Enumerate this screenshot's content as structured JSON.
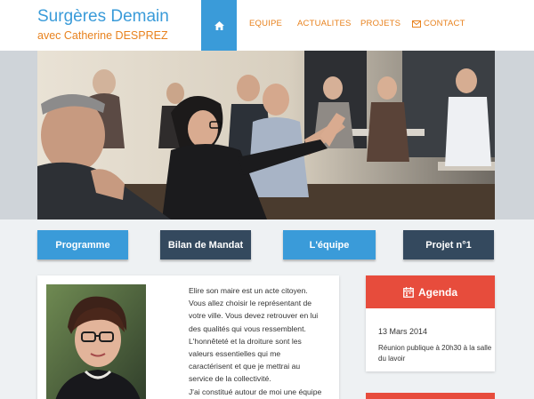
{
  "site": {
    "title": "Surgères Demain",
    "subtitle": "avec Catherine DESPREZ"
  },
  "nav": {
    "home_icon": "home-icon",
    "items": [
      "EQUIPE",
      "ACTUALITES",
      "PROJETS"
    ],
    "contact_label": "CONTACT",
    "contact_icon": "envelope-icon"
  },
  "buttons": [
    "Programme",
    "Bilan de Mandat",
    "L'équipe",
    "Projet n°1"
  ],
  "intro": {
    "lines": [
      "Elire son maire est un acte citoyen.",
      "Vous allez choisir le représentant de",
      "votre ville. Vous devez retrouver en lui",
      "des qualités qui vous ressemblent.",
      "L'honnêteté et la droiture sont les",
      "valeurs essentielles qui me",
      "caractérisent et que je mettrai au",
      "service de la collectivité.",
      "J'ai constitué autour de moi une équipe"
    ]
  },
  "agenda": {
    "title": "Agenda",
    "icon": "calendar-icon",
    "date": "13 Mars 2014",
    "description": "Réunion publique à 20h30 à la salle du lavoir"
  },
  "colors": {
    "accent_blue": "#3a9bd9",
    "accent_orange": "#e8821e",
    "dark_button": "#34495e",
    "agenda_red": "#e74c3c"
  }
}
